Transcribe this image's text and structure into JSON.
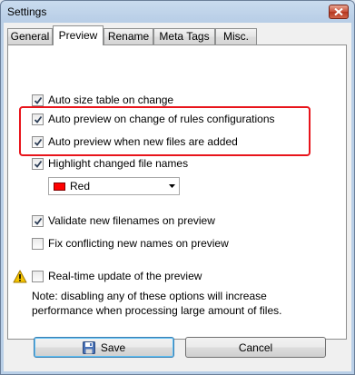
{
  "window": {
    "title": "Settings"
  },
  "tabs": [
    {
      "label": "General"
    },
    {
      "label": "Preview"
    },
    {
      "label": "Rename"
    },
    {
      "label": "Meta Tags"
    },
    {
      "label": "Misc."
    }
  ],
  "options": {
    "auto_size": {
      "label": "Auto size table on change",
      "checked": true
    },
    "auto_preview_rules": {
      "label": "Auto preview on change of rules configurations",
      "checked": true
    },
    "auto_preview_files": {
      "label": "Auto preview when new files are added",
      "checked": true
    },
    "highlight_changed": {
      "label": "Highlight changed file names",
      "checked": true
    },
    "validate": {
      "label": "Validate new filenames on preview",
      "checked": true
    },
    "fix_conflicting": {
      "label": "Fix conflicting new names on preview",
      "checked": false
    },
    "realtime": {
      "label": "Real-time update of the preview",
      "checked": false
    }
  },
  "highlight_color": {
    "selected": "Red",
    "swatch": "#ff0000"
  },
  "note": "Note: disabling any of these options will increase performance when processing large amount of files.",
  "buttons": {
    "save": "Save",
    "cancel": "Cancel"
  },
  "colors": {
    "annotation_box": "#e8141b",
    "warning": "#f5c400"
  }
}
